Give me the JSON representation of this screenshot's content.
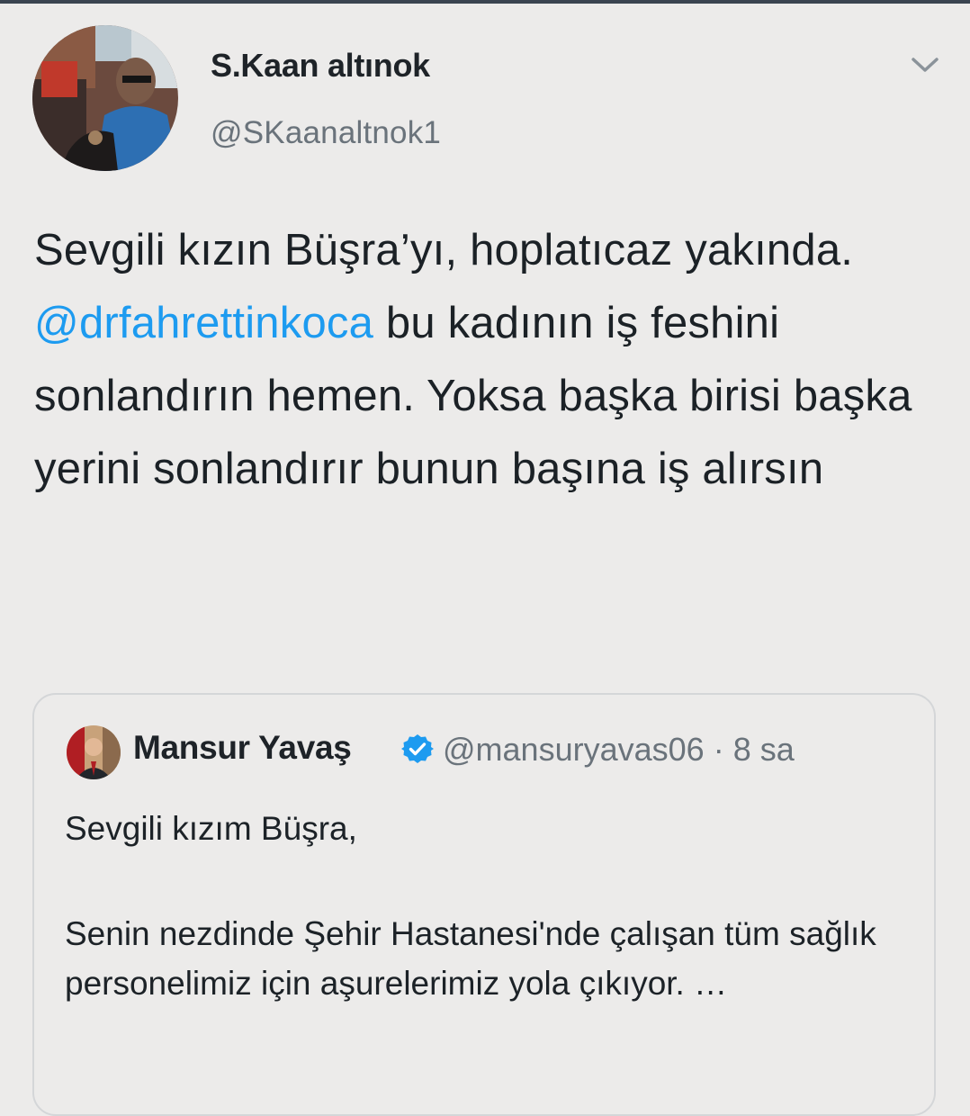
{
  "tweet": {
    "author_name": "S.Kaan altınok",
    "author_handle": "@SKaanaltnok1",
    "menu_icon": "chevron-down-icon",
    "text_before_mention": "Sevgili kızın Büşra’yı, hoplatıcaz yakında. ",
    "mention": "@drfahrettinkoca",
    "text_after_mention": " bu kadının iş feshini sonlandırın hemen. Yoksa başka birisi başka yerini sonlandırır bunun başına iş alırsın"
  },
  "quoted_tweet": {
    "author_name": "Mansur Yavaş",
    "verified_icon": "verified-badge-icon",
    "author_handle": "@mansuryavas06",
    "separator": "·",
    "time": "8 sa",
    "greeting": "Sevgili kızım Büşra,",
    "body": "Senin nezdinde Şehir Hastanesi'nde çalışan tüm sağlık personelimiz için aşurelerimiz yola çıkıyor. …"
  },
  "colors": {
    "background": "#ecebea",
    "mention": "#1d9bf0",
    "verified": "#1d9bf0",
    "secondary_text": "#6a737b"
  }
}
